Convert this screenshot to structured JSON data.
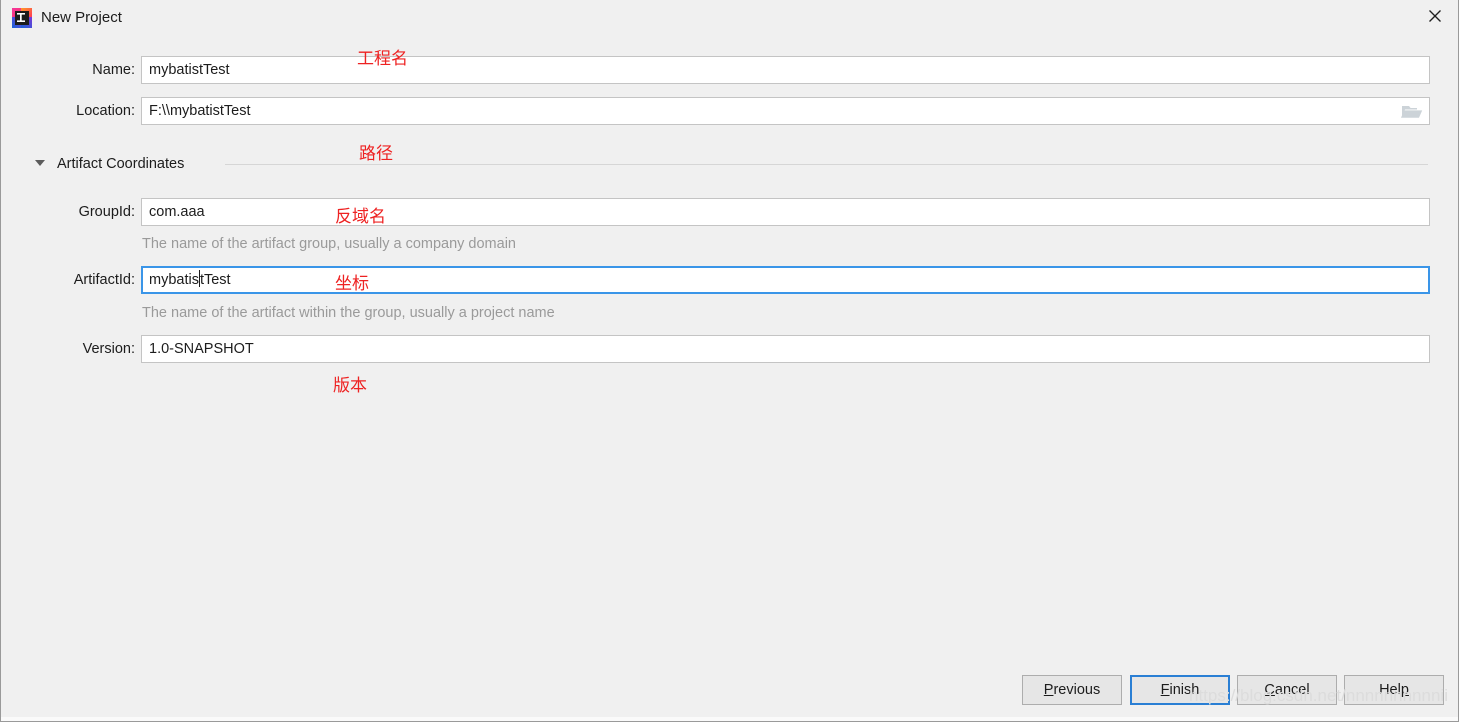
{
  "window": {
    "title": "New Project",
    "app_icon": "intellij-idea-icon",
    "close_icon": "close-icon"
  },
  "form": {
    "name": {
      "label": "Name:",
      "value": "mybatistTest"
    },
    "location": {
      "label": "Location:",
      "value": "F:\\\\mybatistTest",
      "browse_icon": "folder-icon"
    },
    "section": {
      "label": "Artifact Coordinates",
      "expanded": true,
      "collapse_icon": "chevron-down-icon"
    },
    "group_id": {
      "label": "GroupId:",
      "value": "com.aaa",
      "hint": "The name of the artifact group, usually a company domain"
    },
    "artifact_id": {
      "label": "ArtifactId:",
      "value_before_caret": "mybatis",
      "value_after_caret": "tTest",
      "value": "mybatistTest",
      "hint": "The name of the artifact within the group, usually a project name",
      "focused": true
    },
    "version": {
      "label": "Version:",
      "value": "1.0-SNAPSHOT"
    }
  },
  "annotations": [
    {
      "text": "工程名",
      "meaning": "project-name"
    },
    {
      "text": "路径",
      "meaning": "path"
    },
    {
      "text": "反域名",
      "meaning": "reverse-domain"
    },
    {
      "text": "坐标",
      "meaning": "coordinates"
    },
    {
      "text": "版本",
      "meaning": "version"
    }
  ],
  "buttons": {
    "previous": {
      "label": "Previous",
      "mnemonic": "P"
    },
    "finish": {
      "label": "Finish",
      "mnemonic": "F",
      "default": true
    },
    "cancel": {
      "label": "Cancel",
      "mnemonic": "C"
    },
    "help": {
      "label": "Help",
      "mnemonic": "H"
    }
  },
  "watermark": "https://blog.csdn.net/nnnnnnnnnnii",
  "colors": {
    "dialog_bg": "#f0f0f0",
    "field_bg": "#ffffff",
    "field_border": "#c4c4c4",
    "focus_blue": "#3a95e8",
    "default_button_blue": "#2a7fd4",
    "annotation_red": "#ee2222",
    "hint_gray": "#9a9a9a",
    "text": "#1c1c1c"
  }
}
